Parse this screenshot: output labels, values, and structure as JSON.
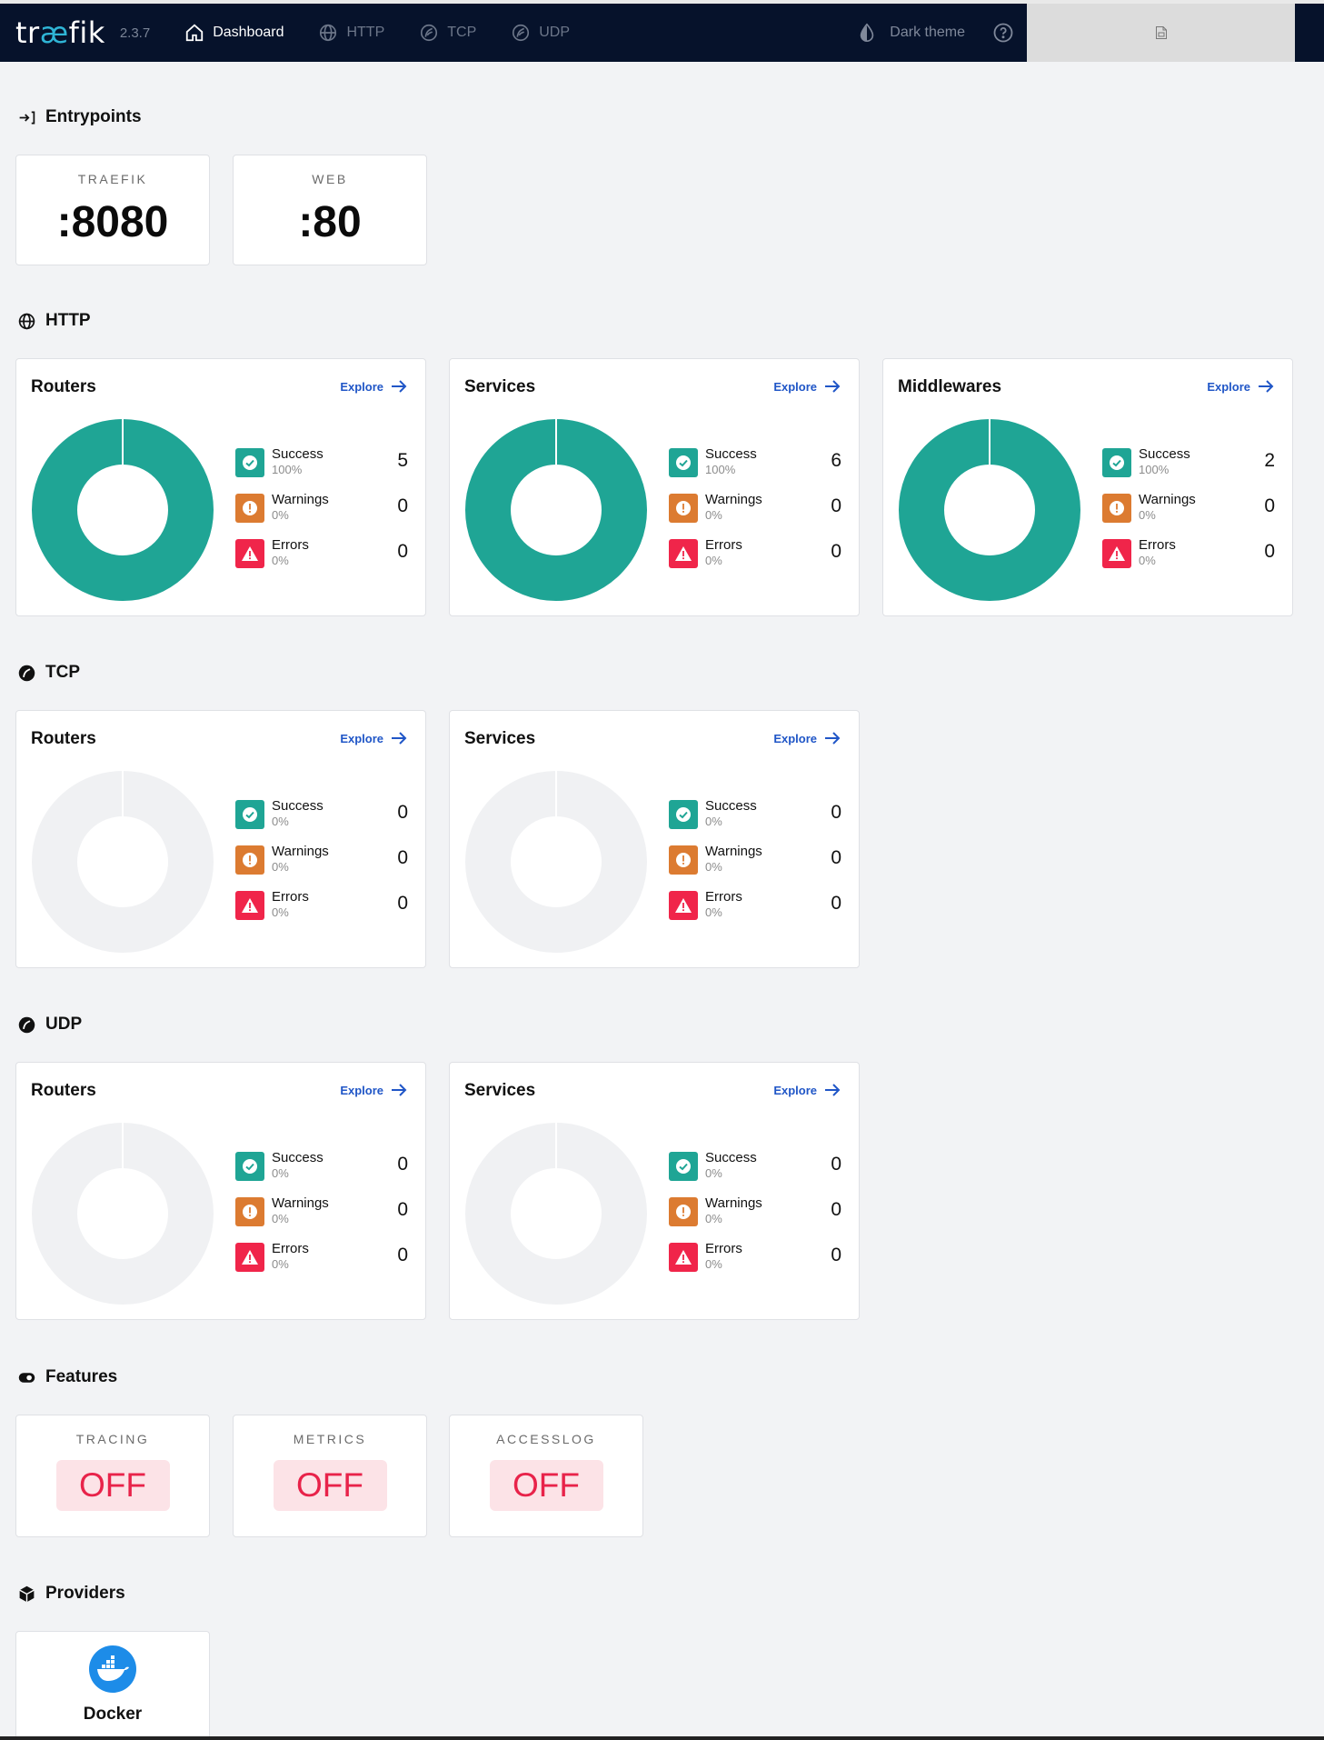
{
  "nav": {
    "logo_prefix": "tr",
    "logo_ae": "æ",
    "logo_suffix": "fik",
    "version": "2.3.7",
    "items": [
      {
        "label": "Dashboard",
        "icon": "home-icon",
        "active": true
      },
      {
        "label": "HTTP",
        "icon": "globe-icon",
        "active": false
      },
      {
        "label": "TCP",
        "icon": "tcp-icon",
        "active": false
      },
      {
        "label": "UDP",
        "icon": "udp-icon",
        "active": false
      }
    ],
    "dark_theme_label": "Dark theme",
    "help_icon": "help-icon"
  },
  "colors": {
    "success": "#1fa595",
    "warning": "#dc7b31",
    "error": "#f0254a",
    "empty": "#f0f1f3",
    "accent": "#2056c7",
    "navbar": "#06122b"
  },
  "entrypoints": {
    "title": "Entrypoints",
    "items": [
      {
        "name": "TRAEFIK",
        "port": ":8080"
      },
      {
        "name": "WEB",
        "port": ":80"
      }
    ]
  },
  "sections": [
    {
      "title": "HTTP",
      "cards": [
        {
          "title": "Routers",
          "explore": "Explore",
          "success": {
            "label": "Success",
            "pct": "100%",
            "count": "5"
          },
          "warnings": {
            "label": "Warnings",
            "pct": "0%",
            "count": "0"
          },
          "errors": {
            "label": "Errors",
            "pct": "0%",
            "count": "0"
          },
          "success_fraction": 1
        },
        {
          "title": "Services",
          "explore": "Explore",
          "success": {
            "label": "Success",
            "pct": "100%",
            "count": "6"
          },
          "warnings": {
            "label": "Warnings",
            "pct": "0%",
            "count": "0"
          },
          "errors": {
            "label": "Errors",
            "pct": "0%",
            "count": "0"
          },
          "success_fraction": 1
        },
        {
          "title": "Middlewares",
          "explore": "Explore",
          "success": {
            "label": "Success",
            "pct": "100%",
            "count": "2"
          },
          "warnings": {
            "label": "Warnings",
            "pct": "0%",
            "count": "0"
          },
          "errors": {
            "label": "Errors",
            "pct": "0%",
            "count": "0"
          },
          "success_fraction": 1
        }
      ]
    },
    {
      "title": "TCP",
      "cards": [
        {
          "title": "Routers",
          "explore": "Explore",
          "success": {
            "label": "Success",
            "pct": "0%",
            "count": "0"
          },
          "warnings": {
            "label": "Warnings",
            "pct": "0%",
            "count": "0"
          },
          "errors": {
            "label": "Errors",
            "pct": "0%",
            "count": "0"
          },
          "success_fraction": 0
        },
        {
          "title": "Services",
          "explore": "Explore",
          "success": {
            "label": "Success",
            "pct": "0%",
            "count": "0"
          },
          "warnings": {
            "label": "Warnings",
            "pct": "0%",
            "count": "0"
          },
          "errors": {
            "label": "Errors",
            "pct": "0%",
            "count": "0"
          },
          "success_fraction": 0
        }
      ]
    },
    {
      "title": "UDP",
      "cards": [
        {
          "title": "Routers",
          "explore": "Explore",
          "success": {
            "label": "Success",
            "pct": "0%",
            "count": "0"
          },
          "warnings": {
            "label": "Warnings",
            "pct": "0%",
            "count": "0"
          },
          "errors": {
            "label": "Errors",
            "pct": "0%",
            "count": "0"
          },
          "success_fraction": 0
        },
        {
          "title": "Services",
          "explore": "Explore",
          "success": {
            "label": "Success",
            "pct": "0%",
            "count": "0"
          },
          "warnings": {
            "label": "Warnings",
            "pct": "0%",
            "count": "0"
          },
          "errors": {
            "label": "Errors",
            "pct": "0%",
            "count": "0"
          },
          "success_fraction": 0
        }
      ]
    }
  ],
  "features": {
    "title": "Features",
    "items": [
      {
        "name": "TRACING",
        "state": "OFF"
      },
      {
        "name": "METRICS",
        "state": "OFF"
      },
      {
        "name": "ACCESSLOG",
        "state": "OFF"
      }
    ]
  },
  "providers": {
    "title": "Providers",
    "items": [
      {
        "name": "Docker",
        "icon": "docker-icon"
      }
    ]
  }
}
